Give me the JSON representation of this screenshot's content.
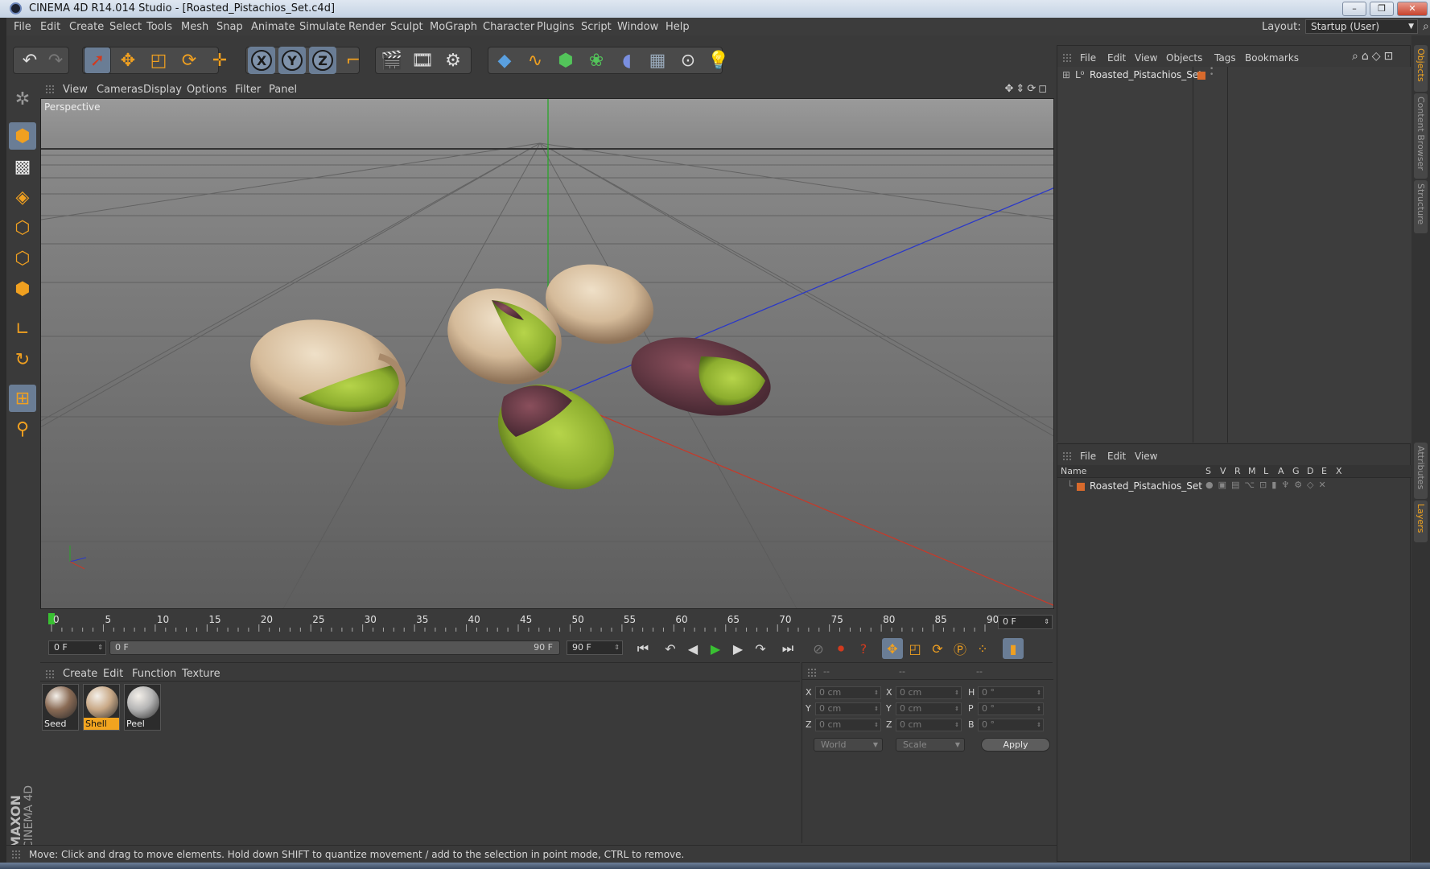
{
  "window": {
    "title": "CINEMA 4D R14.014 Studio - [Roasted_Pistachios_Set.c4d]",
    "minimize_label": "–",
    "restore_label": "❐",
    "close_label": "✕"
  },
  "menubar": {
    "items": [
      "File",
      "Edit",
      "Create",
      "Select",
      "Tools",
      "Mesh",
      "Snap",
      "Animate",
      "Simulate",
      "Render",
      "Sculpt",
      "MoGraph",
      "Character",
      "Plugins",
      "Script",
      "Window",
      "Help"
    ],
    "layout_label": "Layout:",
    "layout_value": "Startup (User)"
  },
  "toolbar": {
    "axis_x": "X",
    "axis_y": "Y",
    "axis_z": "Z",
    "icons": [
      "undo-icon",
      "redo-icon",
      "select-arrow-icon",
      "move-icon",
      "scale-icon",
      "rotate-icon",
      "add-object-icon",
      "axis-x-icon",
      "axis-y-icon",
      "axis-z-icon",
      "coordinate-system-icon",
      "render-view-icon",
      "render-picture-queue-icon",
      "render-settings-icon",
      "cube-primitive-icon",
      "spline-icon",
      "nurbs-icon",
      "mograph-cloner-icon",
      "deformer-icon",
      "floor-icon",
      "camera-icon",
      "light-icon"
    ]
  },
  "viewport": {
    "menu": [
      "View",
      "Cameras",
      "Display",
      "Options",
      "Filter",
      "Panel"
    ],
    "label": "Perspective",
    "objects": [
      "pistachio-in-shell-left",
      "pistachio-open-shell-center",
      "empty-shell-half",
      "peeled-kernel-right",
      "peeled-kernel-front"
    ]
  },
  "timeline": {
    "ticks": [
      "0",
      "5",
      "10",
      "15",
      "20",
      "25",
      "30",
      "35",
      "40",
      "45",
      "50",
      "55",
      "60",
      "65",
      "70",
      "75",
      "80",
      "85",
      "90"
    ],
    "current_frame": "0 F"
  },
  "transport": {
    "start_field": "0 F",
    "range_start": "0 F",
    "range_end": "90 F",
    "end_field": "90 F"
  },
  "material_manager": {
    "menu": [
      "Create",
      "Edit",
      "Function",
      "Texture"
    ],
    "materials": [
      {
        "name": "Seed",
        "selected": false,
        "color": "#8a6b55"
      },
      {
        "name": "Shell",
        "selected": true,
        "color": "#c9a987"
      },
      {
        "name": "Peel",
        "selected": false,
        "color": "#b5b5b5"
      }
    ]
  },
  "coordinates": {
    "header": [
      "--",
      "--",
      "--"
    ],
    "rows": [
      {
        "a": "X",
        "a_val": "0 cm",
        "b": "X",
        "b_val": "0 cm",
        "c": "H",
        "c_val": "0 °"
      },
      {
        "a": "Y",
        "a_val": "0 cm",
        "b": "Y",
        "b_val": "0 cm",
        "c": "P",
        "c_val": "0 °"
      },
      {
        "a": "Z",
        "a_val": "0 cm",
        "b": "Z",
        "b_val": "0 cm",
        "c": "B",
        "c_val": "0 °"
      }
    ],
    "mode": "World",
    "transform": "Scale",
    "apply": "Apply"
  },
  "status": {
    "text": "Move: Click and drag to move elements. Hold down SHIFT to quantize movement / add to the selection in point mode, CTRL to remove."
  },
  "object_manager": {
    "menu": [
      "File",
      "Edit",
      "View",
      "Objects",
      "Tags",
      "Bookmarks"
    ],
    "objects": [
      {
        "name": "Roasted_Pistachios_Set",
        "layer_color": "#d86a2c"
      }
    ]
  },
  "layer_manager": {
    "menu": [
      "File",
      "Edit",
      "View"
    ],
    "columns": [
      "Name",
      "S",
      "V",
      "R",
      "M",
      "L",
      "A",
      "G",
      "D",
      "E",
      "X"
    ],
    "layers": [
      {
        "name": "Roasted_Pistachios_Set"
      }
    ]
  },
  "right_tabs": [
    "Objects",
    "Content Browser",
    "Structure",
    "Attributes",
    "Layers"
  ],
  "logo": {
    "brand": "MAXON",
    "product": "CINEMA 4D"
  },
  "colors": {
    "accent": "#f2a41f",
    "background": "#3a3a3a",
    "active_tool": "#6a7d95"
  }
}
